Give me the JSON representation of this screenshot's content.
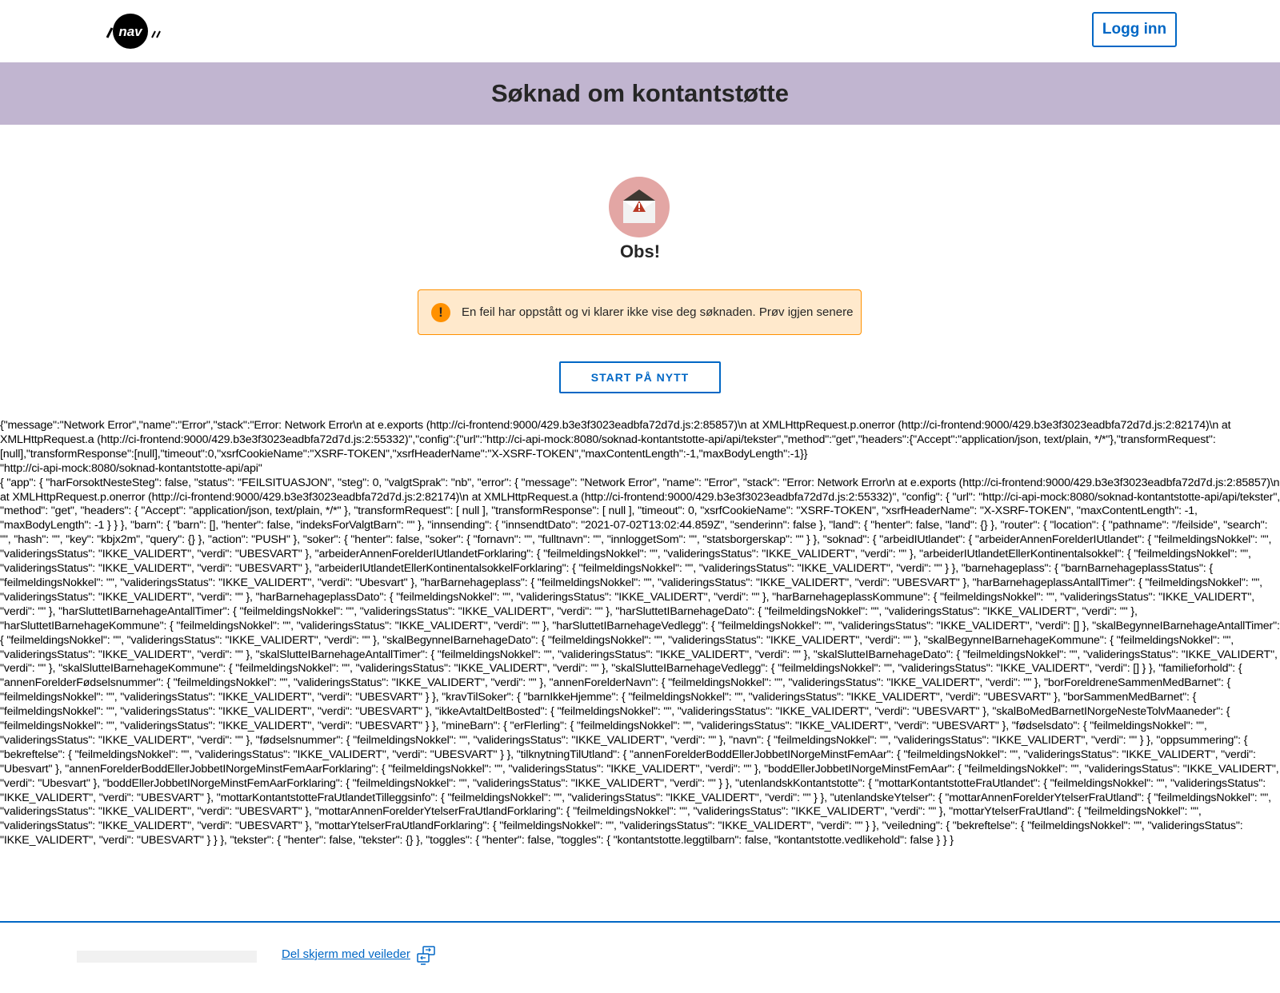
{
  "header": {
    "logo_text": "nav",
    "login_label": "Logg inn"
  },
  "banner": {
    "title": "Søknad om kontantstøtte"
  },
  "error": {
    "heading": "Obs!",
    "alert_text": "En feil har oppstått og vi klarer ikke vise deg søknaden. Prøv igjen senere",
    "restart_label": "START PÅ NYTT"
  },
  "debug": {
    "error_json": "{\"message\":\"Network Error\",\"name\":\"Error\",\"stack\":\"Error: Network Error\\n at e.exports (http://ci-frontend:9000/429.b3e3f3023eadbfa72d7d.js:2:85857)\\n at XMLHttpRequest.p.onerror (http://ci-frontend:9000/429.b3e3f3023eadbfa72d7d.js:2:82174)\\n at XMLHttpRequest.a (http://ci-frontend:9000/429.b3e3f3023eadbfa72d7d.js:2:55332)\",\"config\":{\"url\":\"http://ci-api-mock:8080/soknad-kontantstotte-api/api/tekster\",\"method\":\"get\",\"headers\":{\"Accept\":\"application/json, text/plain, */*\"},\"transformRequest\":[null],\"transformResponse\":[null],\"timeout\":0,\"xsrfCookieName\":\"XSRF-TOKEN\",\"xsrfHeaderName\":\"X-XSRF-TOKEN\",\"maxContentLength\":-1,\"maxBodyLength\":-1}}",
    "api_url": "\"http://ci-api-mock:8080/soknad-kontantstotte-api/api\"",
    "state_json": "{ \"app\": { \"harForsoktNesteSteg\": false, \"status\": \"FEILSITUASJON\", \"steg\": 0, \"valgtSprak\": \"nb\", \"error\": { \"message\": \"Network Error\", \"name\": \"Error\", \"stack\": \"Error: Network Error\\n at e.exports (http://ci-frontend:9000/429.b3e3f3023eadbfa72d7d.js:2:85857)\\n at XMLHttpRequest.p.onerror (http://ci-frontend:9000/429.b3e3f3023eadbfa72d7d.js:2:82174)\\n at XMLHttpRequest.a (http://ci-frontend:9000/429.b3e3f3023eadbfa72d7d.js:2:55332)\", \"config\": { \"url\": \"http://ci-api-mock:8080/soknad-kontantstotte-api/api/tekster\", \"method\": \"get\", \"headers\": { \"Accept\": \"application/json, text/plain, */*\" }, \"transformRequest\": [ null ], \"transformResponse\": [ null ], \"timeout\": 0, \"xsrfCookieName\": \"XSRF-TOKEN\", \"xsrfHeaderName\": \"X-XSRF-TOKEN\", \"maxContentLength\": -1, \"maxBodyLength\": -1 } } }, \"barn\": { \"barn\": [], \"henter\": false, \"indeksForValgtBarn\": \"\" }, \"innsending\": { \"innsendtDato\": \"2021-07-02T13:02:44.859Z\", \"senderinn\": false }, \"land\": { \"henter\": false, \"land\": {} }, \"router\": { \"location\": { \"pathname\": \"/feilside\", \"search\": \"\", \"hash\": \"\", \"key\": \"kbjx2m\", \"query\": {} }, \"action\": \"PUSH\" }, \"soker\": { \"henter\": false, \"soker\": { \"fornavn\": \"\", \"fulltnavn\": \"\", \"innloggetSom\": \"\", \"statsborgerskap\": \"\" } }, \"soknad\": { \"arbeidIUtlandet\": { \"arbeiderAnnenForelderIUtlandet\": { \"feilmeldingsNokkel\": \"\", \"valideringsStatus\": \"IKKE_VALIDERT\", \"verdi\": \"UBESVART\" }, \"arbeiderAnnenForelderIUtlandetForklaring\": { \"feilmeldingsNokkel\": \"\", \"valideringsStatus\": \"IKKE_VALIDERT\", \"verdi\": \"\" }, \"arbeiderIUtlandetEllerKontinentalsokkel\": { \"feilmeldingsNokkel\": \"\", \"valideringsStatus\": \"IKKE_VALIDERT\", \"verdi\": \"UBESVART\" }, \"arbeiderIUtlandetEllerKontinentalsokkelForklaring\": { \"feilmeldingsNokkel\": \"\", \"valideringsStatus\": \"IKKE_VALIDERT\", \"verdi\": \"\" } }, \"barnehageplass\": { \"barnBarnehageplassStatus\": { \"feilmeldingsNokkel\": \"\", \"valideringsStatus\": \"IKKE_VALIDERT\", \"verdi\": \"Ubesvart\" }, \"harBarnehageplass\": { \"feilmeldingsNokkel\": \"\", \"valideringsStatus\": \"IKKE_VALIDERT\", \"verdi\": \"UBESVART\" }, \"harBarnehageplassAntallTimer\": { \"feilmeldingsNokkel\": \"\", \"valideringsStatus\": \"IKKE_VALIDERT\", \"verdi\": \"\" }, \"harBarnehageplassDato\": { \"feilmeldingsNokkel\": \"\", \"valideringsStatus\": \"IKKE_VALIDERT\", \"verdi\": \"\" }, \"harBarnehageplassKommune\": { \"feilmeldingsNokkel\": \"\", \"valideringsStatus\": \"IKKE_VALIDERT\", \"verdi\": \"\" }, \"harSluttetIBarnehageAntallTimer\": { \"feilmeldingsNokkel\": \"\", \"valideringsStatus\": \"IKKE_VALIDERT\", \"verdi\": \"\" }, \"harSluttetIBarnehageDato\": { \"feilmeldingsNokkel\": \"\", \"valideringsStatus\": \"IKKE_VALIDERT\", \"verdi\": \"\" }, \"harSluttetIBarnehageKommune\": { \"feilmeldingsNokkel\": \"\", \"valideringsStatus\": \"IKKE_VALIDERT\", \"verdi\": \"\" }, \"harSluttetIBarnehageVedlegg\": { \"feilmeldingsNokkel\": \"\", \"valideringsStatus\": \"IKKE_VALIDERT\", \"verdi\": [] }, \"skalBegynneIBarnehageAntallTimer\": { \"feilmeldingsNokkel\": \"\", \"valideringsStatus\": \"IKKE_VALIDERT\", \"verdi\": \"\" }, \"skalBegynneIBarnehageDato\": { \"feilmeldingsNokkel\": \"\", \"valideringsStatus\": \"IKKE_VALIDERT\", \"verdi\": \"\" }, \"skalBegynneIBarnehageKommune\": { \"feilmeldingsNokkel\": \"\", \"valideringsStatus\": \"IKKE_VALIDERT\", \"verdi\": \"\" }, \"skalSlutteIBarnehageAntallTimer\": { \"feilmeldingsNokkel\": \"\", \"valideringsStatus\": \"IKKE_VALIDERT\", \"verdi\": \"\" }, \"skalSlutteIBarnehageDato\": { \"feilmeldingsNokkel\": \"\", \"valideringsStatus\": \"IKKE_VALIDERT\", \"verdi\": \"\" }, \"skalSlutteIBarnehageKommune\": { \"feilmeldingsNokkel\": \"\", \"valideringsStatus\": \"IKKE_VALIDERT\", \"verdi\": \"\" }, \"skalSlutteIBarnehageVedlegg\": { \"feilmeldingsNokkel\": \"\", \"valideringsStatus\": \"IKKE_VALIDERT\", \"verdi\": [] } }, \"familieforhold\": { \"annenForelderFødselsnummer\": { \"feilmeldingsNokkel\": \"\", \"valideringsStatus\": \"IKKE_VALIDERT\", \"verdi\": \"\" }, \"annenForelderNavn\": { \"feilmeldingsNokkel\": \"\", \"valideringsStatus\": \"IKKE_VALIDERT\", \"verdi\": \"\" }, \"borForeldreneSammenMedBarnet\": { \"feilmeldingsNokkel\": \"\", \"valideringsStatus\": \"IKKE_VALIDERT\", \"verdi\": \"UBESVART\" } }, \"kravTilSoker\": { \"barnIkkeHjemme\": { \"feilmeldingsNokkel\": \"\", \"valideringsStatus\": \"IKKE_VALIDERT\", \"verdi\": \"UBESVART\" }, \"borSammenMedBarnet\": { \"feilmeldingsNokkel\": \"\", \"valideringsStatus\": \"IKKE_VALIDERT\", \"verdi\": \"UBESVART\" }, \"ikkeAvtaltDeltBosted\": { \"feilmeldingsNokkel\": \"\", \"valideringsStatus\": \"IKKE_VALIDERT\", \"verdi\": \"UBESVART\" }, \"skalBoMedBarnetINorgeNesteTolvMaaneder\": { \"feilmeldingsNokkel\": \"\", \"valideringsStatus\": \"IKKE_VALIDERT\", \"verdi\": \"UBESVART\" } }, \"mineBarn\": { \"erFlerling\": { \"feilmeldingsNokkel\": \"\", \"valideringsStatus\": \"IKKE_VALIDERT\", \"verdi\": \"UBESVART\" }, \"fødselsdato\": { \"feilmeldingsNokkel\": \"\", \"valideringsStatus\": \"IKKE_VALIDERT\", \"verdi\": \"\" }, \"fødselsnummer\": { \"feilmeldingsNokkel\": \"\", \"valideringsStatus\": \"IKKE_VALIDERT\", \"verdi\": \"\" }, \"navn\": { \"feilmeldingsNokkel\": \"\", \"valideringsStatus\": \"IKKE_VALIDERT\", \"verdi\": \"\" } }, \"oppsummering\": { \"bekreftelse\": { \"feilmeldingsNokkel\": \"\", \"valideringsStatus\": \"IKKE_VALIDERT\", \"verdi\": \"UBESVART\" } }, \"tilknytningTilUtland\": { \"annenForelderBoddEllerJobbetINorgeMinstFemAar\": { \"feilmeldingsNokkel\": \"\", \"valideringsStatus\": \"IKKE_VALIDERT\", \"verdi\": \"Ubesvart\" }, \"annenForelderBoddEllerJobbetINorgeMinstFemAarForklaring\": { \"feilmeldingsNokkel\": \"\", \"valideringsStatus\": \"IKKE_VALIDERT\", \"verdi\": \"\" }, \"boddEllerJobbetINorgeMinstFemAar\": { \"feilmeldingsNokkel\": \"\", \"valideringsStatus\": \"IKKE_VALIDERT\", \"verdi\": \"Ubesvart\" }, \"boddEllerJobbetINorgeMinstFemAarForklaring\": { \"feilmeldingsNokkel\": \"\", \"valideringsStatus\": \"IKKE_VALIDERT\", \"verdi\": \"\" } }, \"utenlandskKontantstotte\": { \"mottarKontantstotteFraUtlandet\": { \"feilmeldingsNokkel\": \"\", \"valideringsStatus\": \"IKKE_VALIDERT\", \"verdi\": \"UBESVART\" }, \"mottarKontantstotteFraUtlandetTilleggsinfo\": { \"feilmeldingsNokkel\": \"\", \"valideringsStatus\": \"IKKE_VALIDERT\", \"verdi\": \"\" } }, \"utenlandskeYtelser\": { \"mottarAnnenForelderYtelserFraUtland\": { \"feilmeldingsNokkel\": \"\", \"valideringsStatus\": \"IKKE_VALIDERT\", \"verdi\": \"UBESVART\" }, \"mottarAnnenForelderYtelserFraUtlandForklaring\": { \"feilmeldingsNokkel\": \"\", \"valideringsStatus\": \"IKKE_VALIDERT\", \"verdi\": \"\" }, \"mottarYtelserFraUtland\": { \"feilmeldingsNokkel\": \"\", \"valideringsStatus\": \"IKKE_VALIDERT\", \"verdi\": \"UBESVART\" }, \"mottarYtelserFraUtlandForklaring\": { \"feilmeldingsNokkel\": \"\", \"valideringsStatus\": \"IKKE_VALIDERT\", \"verdi\": \"\" } }, \"veiledning\": { \"bekreftelse\": { \"feilmeldingsNokkel\": \"\", \"valideringsStatus\": \"IKKE_VALIDERT\", \"verdi\": \"UBESVART\" } } }, \"tekster\": { \"henter\": false, \"tekster\": {} }, \"toggles\": { \"henter\": false, \"toggles\": { \"kontantstotte.leggtilbarn\": false, \"kontantstotte.vedlikehold\": false } } }"
  },
  "footer": {
    "share_screen_label": "Del skjerm med veileder"
  },
  "colors": {
    "accent": "#0067c5",
    "banner": "#c1b5d0",
    "alert_bg": "#ffe9cc",
    "alert_border": "#ff9100",
    "illustration_bg": "#e3a6a4"
  },
  "icons": {
    "logo": "nav-logo",
    "alert": "warning-circle-icon",
    "illustration": "envelope-warning-icon",
    "share": "share-screen-icon"
  }
}
